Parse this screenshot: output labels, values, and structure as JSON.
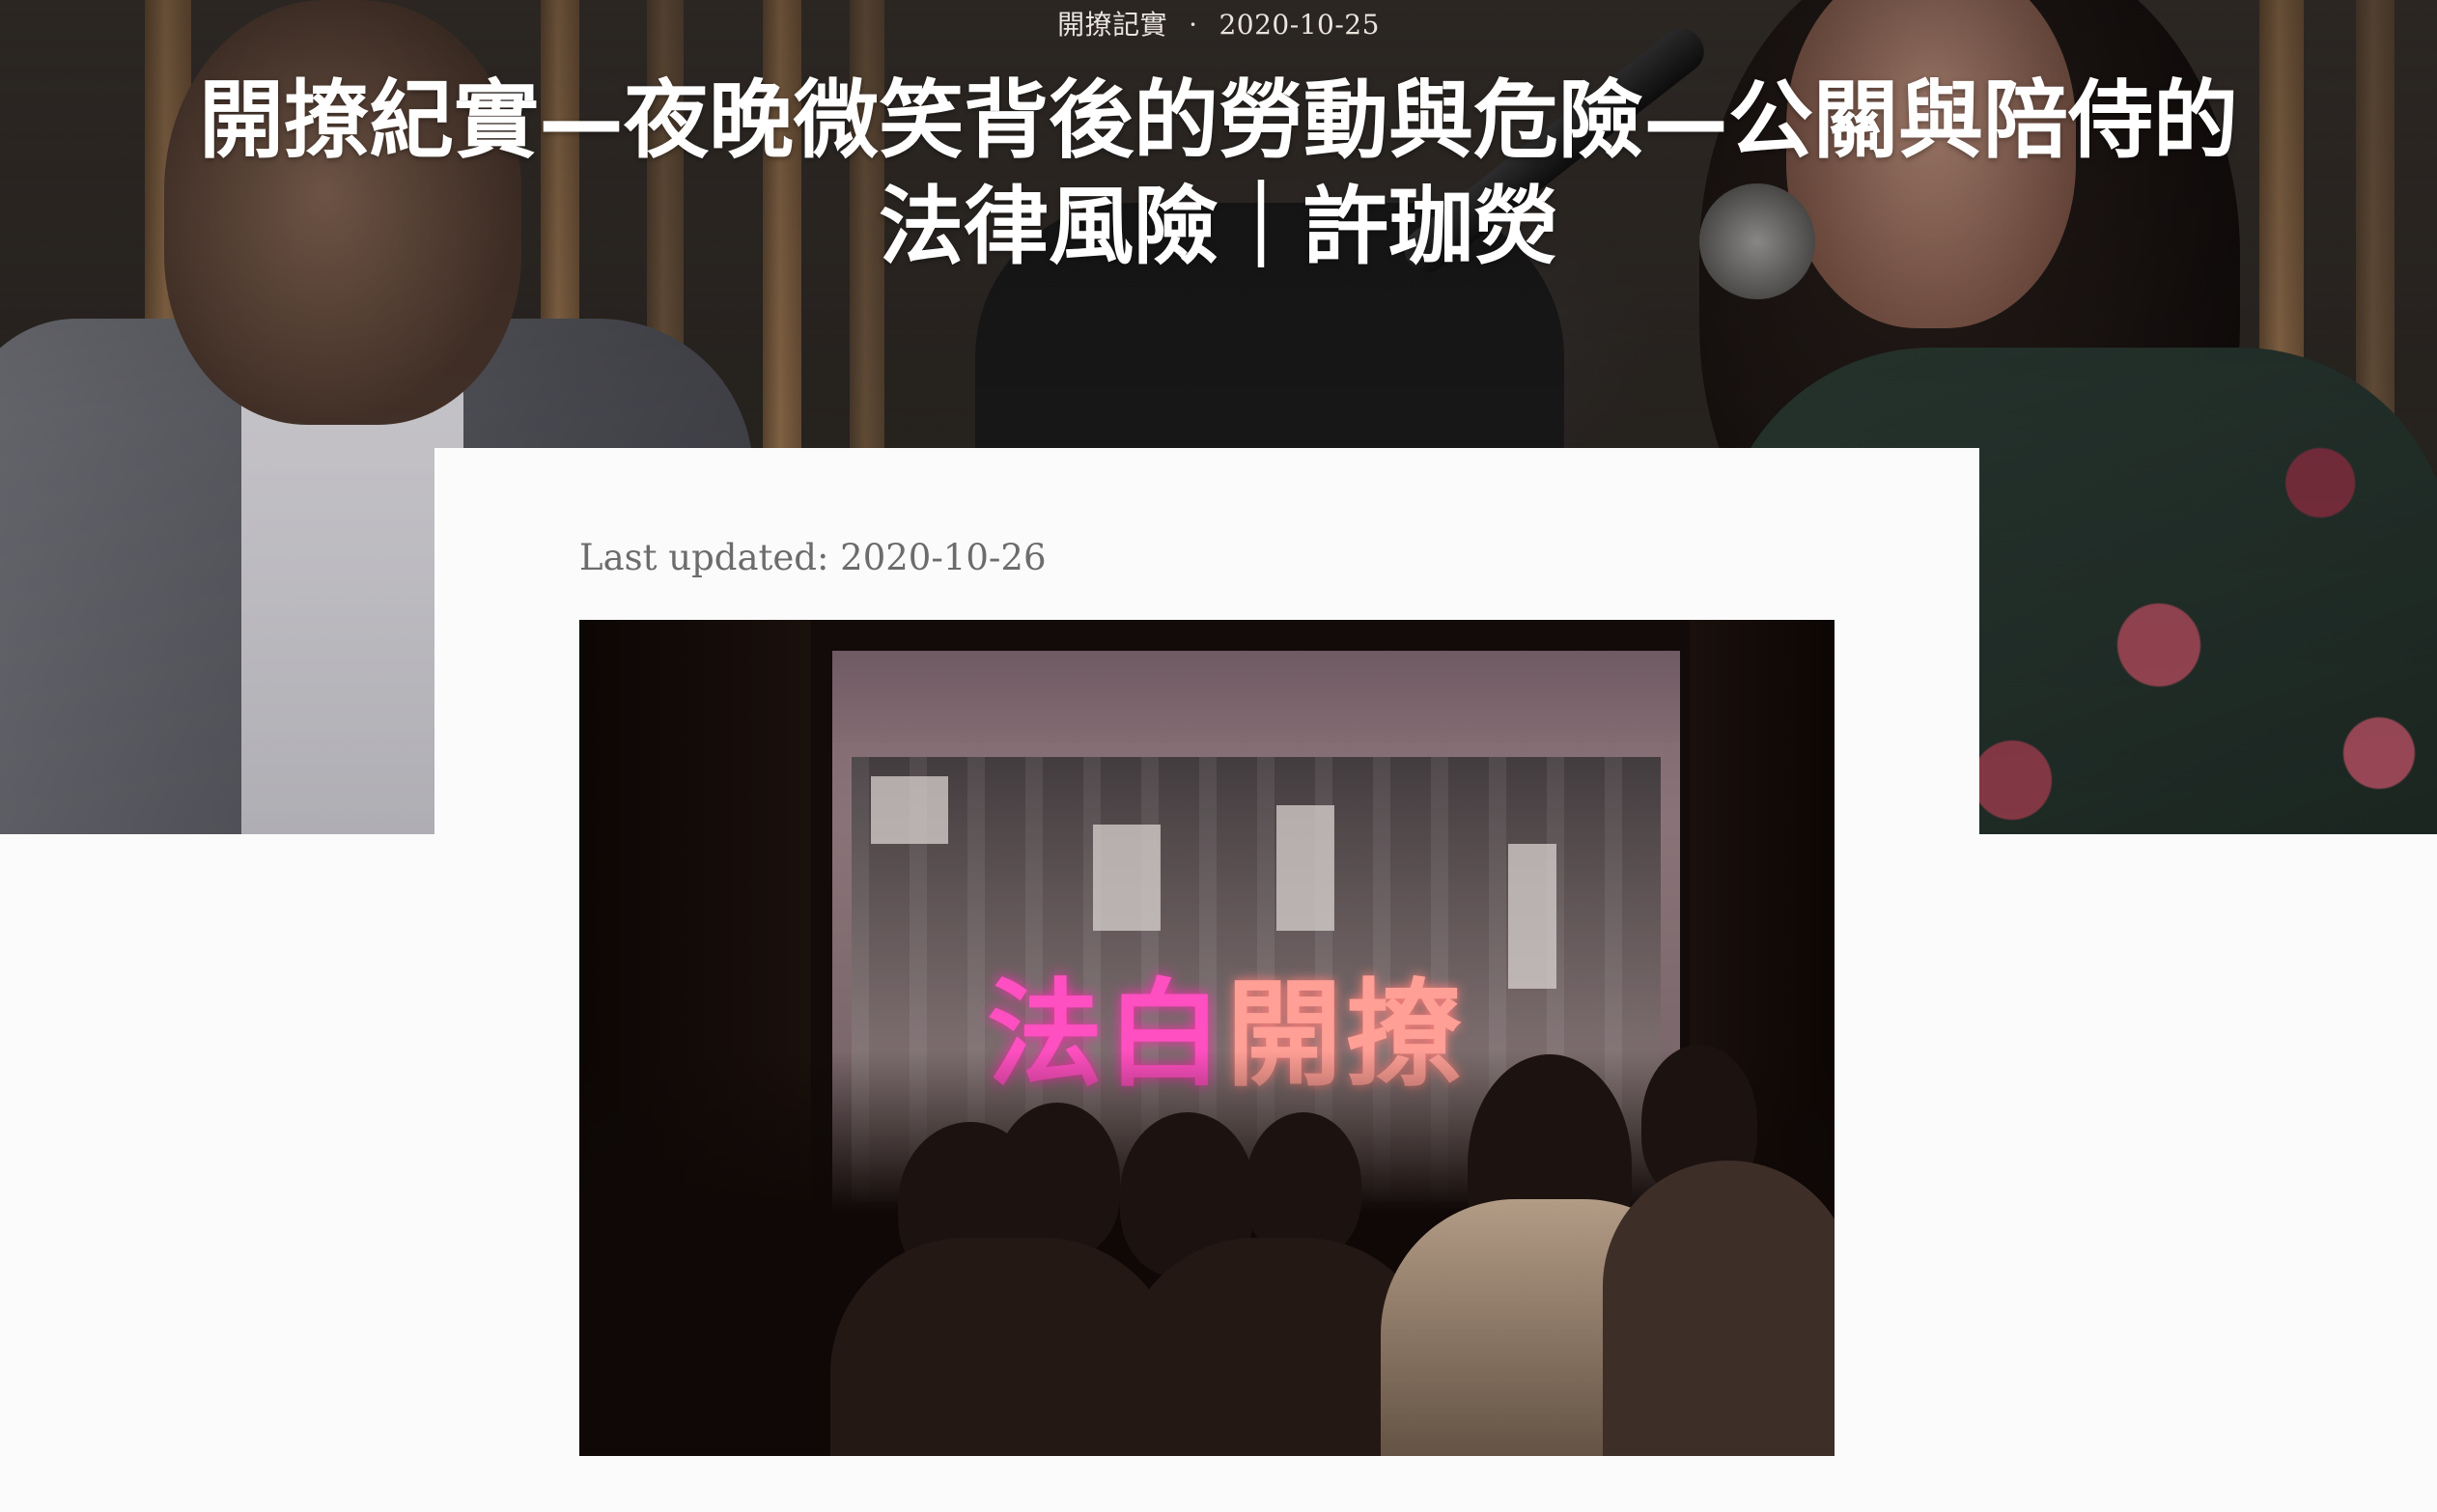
{
  "post": {
    "category": "開撩記實",
    "separator": "·",
    "date": "2020-10-25",
    "title": "開撩紀實—夜晚微笑背後的勞動與危險—公關與陪侍的法律風險｜許珈熒",
    "last_updated": "Last updated: 2020-10-26"
  },
  "photo": {
    "neon_part1": "法白",
    "neon_part2": "開撩"
  }
}
